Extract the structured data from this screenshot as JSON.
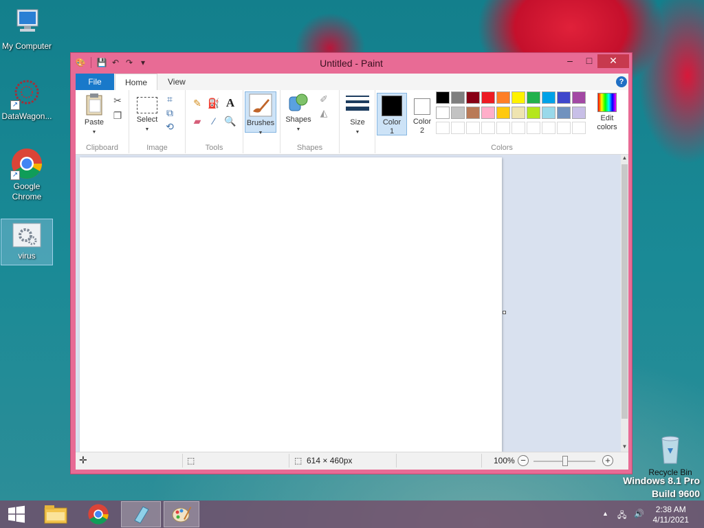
{
  "desktop": {
    "icons": [
      {
        "label": "My Computer"
      },
      {
        "label": "DataWagon..."
      },
      {
        "label": "Google Chrome"
      },
      {
        "label": "virus"
      },
      {
        "label": "Recycle Bin"
      }
    ],
    "watermark_line1": "Windows 8.1 Pro",
    "watermark_line2": "Build 9600"
  },
  "window": {
    "title": "Untitled - Paint",
    "controls": {
      "minimize": "–",
      "maximize": "□",
      "close": "✕"
    }
  },
  "ribbon": {
    "tabs": [
      {
        "label": "File"
      },
      {
        "label": "Home"
      },
      {
        "label": "View"
      }
    ],
    "help": "?",
    "groups": {
      "clipboard": {
        "label": "Clipboard",
        "paste": "Paste"
      },
      "image": {
        "label": "Image",
        "select": "Select"
      },
      "tools": {
        "label": "Tools"
      },
      "brushes": {
        "label": "Brushes"
      },
      "shapes": {
        "label": "Shapes",
        "button": "Shapes"
      },
      "size": {
        "label": "Size"
      },
      "colors": {
        "label": "Colors",
        "color1": "Color",
        "color1_num": "1",
        "color2": "Color",
        "color2_num": "2",
        "edit": "Edit",
        "edit2": "colors",
        "color1_value": "#000000",
        "color2_value": "#ffffff",
        "palette_row1": [
          "#000000",
          "#7f7f7f",
          "#880015",
          "#ed1c24",
          "#ff7f27",
          "#fff200",
          "#22b14c",
          "#00a2e8",
          "#3f48cc",
          "#a349a4"
        ],
        "palette_row2": [
          "#ffffff",
          "#c3c3c3",
          "#b97a57",
          "#ffaec9",
          "#ffc90e",
          "#efe4b0",
          "#b5e61d",
          "#99d9ea",
          "#7092be",
          "#c8bfe7"
        ]
      }
    }
  },
  "statusbar": {
    "dimensions": "614 × 460px",
    "zoom": "100%"
  },
  "taskbar": {
    "time": "2:38 AM",
    "date": "4/11/2021"
  }
}
